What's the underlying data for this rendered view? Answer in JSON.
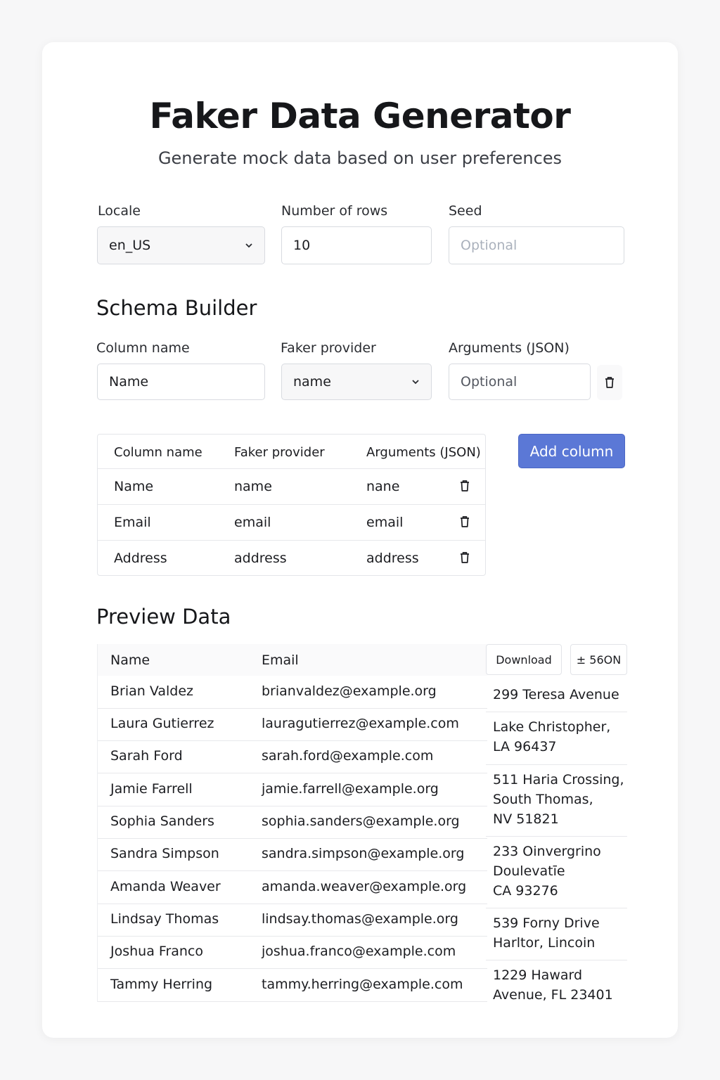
{
  "header": {
    "title": "Faker Data Generator",
    "subtitle": "Generate mock data based on user preferences"
  },
  "settings": {
    "locale_label": "Locale",
    "locale_value": "en_US",
    "rows_label": "Number of rows",
    "rows_value": "10",
    "seed_label": "Seed",
    "seed_placeholder": "Optional"
  },
  "schema": {
    "title": "Schema Builder",
    "column_name_label": "Column name",
    "column_name_value": "Name",
    "provider_label": "Faker provider",
    "provider_value": "name",
    "args_label": "Arguments (JSON)",
    "args_placeholder": "Optional",
    "add_button": "Add column",
    "table_headers": [
      "Column name",
      "Faker provider",
      "Arguments (JSON)"
    ],
    "rows": [
      {
        "column": "Name",
        "provider": "name",
        "args": "nane"
      },
      {
        "column": "Email",
        "provider": "email",
        "args": "email"
      },
      {
        "column": "Address",
        "provider": "address",
        "args": "address"
      }
    ]
  },
  "preview": {
    "title": "Preview Data",
    "headers": [
      "Name",
      "Email"
    ],
    "download_button": "Download",
    "json_button": "± 56ON",
    "rows": [
      {
        "name": "Brian Valdez",
        "email": "brianvaldez@example.org"
      },
      {
        "name": "Laura Gutierrez",
        "email": "lauragutierrez@example.com"
      },
      {
        "name": "Sarah Ford",
        "email": "sarah.ford@example.com"
      },
      {
        "name": "Jamie Farrell",
        "email": "jamie.farrell@example.org"
      },
      {
        "name": "Sophia Sanders",
        "email": "sophia.sanders@example.org"
      },
      {
        "name": "Sandra Simpson",
        "email": "sandra.simpson@example.org"
      },
      {
        "name": "Amanda Weaver",
        "email": "amanda.weaver@example.org"
      },
      {
        "name": "Lindsay Thomas",
        "email": "lindsay.thomas@example.org"
      },
      {
        "name": "Joshua Franco",
        "email": "joshua.franco@example.com"
      },
      {
        "name": "Tammy Herring",
        "email": "tammy.herring@example.com"
      }
    ],
    "addresses": [
      [
        "299 Teresa Avenue"
      ],
      [
        "Lake Christopher,",
        "LA 96437"
      ],
      [
        "511 Haria Crossing,",
        "South Thomas,",
        "NV 51821"
      ],
      [
        "233 Oinvergrino",
        "Doulevatīe",
        "CA 93276"
      ],
      [
        "539 Forny Drive",
        "Harltor, Lincoin"
      ],
      [
        "1229 Haward",
        "Avenue, FL 23401"
      ]
    ]
  },
  "icons": {
    "trash": "trash-icon",
    "chevron": "chevron-down-icon"
  },
  "colors": {
    "accent": "#5b78d6",
    "background": "#f7f7f8",
    "card": "#ffffff"
  }
}
